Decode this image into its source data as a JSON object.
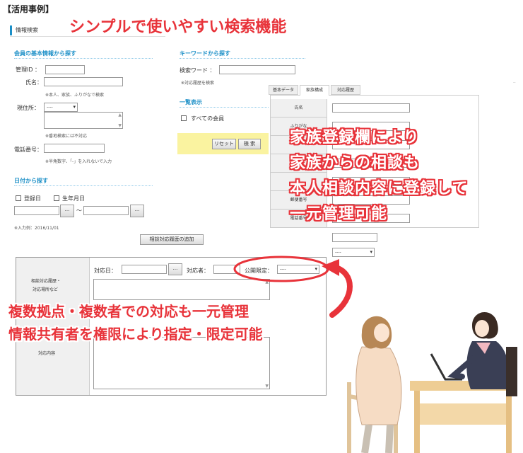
{
  "page_heading": "【活用事例】",
  "tab_info_search": "情報検索",
  "headline": "シンプルで使いやすい検索機能",
  "member_section": {
    "title": "会員の基本情報から探す",
    "admin_id_label": "管理ID ：",
    "name_label": "氏名：",
    "name_note": "※本人、家族、ふりがなで検索",
    "address_label": "現住所：",
    "address_select": "----",
    "address_note": "※番地検索には不対応",
    "phone_label": "電話番号：",
    "phone_note": "※半角数字、「-」を入れないで入力"
  },
  "keyword_section": {
    "title": "キーワードから探す",
    "keyword_label": "検索ワード ：",
    "keyword_note": "※対応履歴を検索"
  },
  "list_section": {
    "title": "一覧表示",
    "all_members_label": "すべての会員"
  },
  "buttons": {
    "reset": "リセット",
    "search": "検 索",
    "add_history": "相談対応履歴の追加",
    "picker": "..."
  },
  "date_section": {
    "title": "日付から探す",
    "registration_date_label": "登録日",
    "birthdate_label": "生年月日",
    "range_sep": "〜",
    "example": "※入力例：2016/11/01"
  },
  "detail_tabs": [
    "基本データ",
    "家族構成",
    "対応履歴"
  ],
  "detail_rows": [
    "氏名",
    "ふりがな",
    "",
    "年齢",
    "",
    "郵便番号",
    "電話番号"
  ],
  "family_overlay_lines": [
    "家族登録欄により",
    "家族からの相談も",
    "本人相談内容に登録して",
    "一元管理可能"
  ],
  "history_form": {
    "row_label_1": "相談対応履歴・",
    "row_label_2": "対応場所など",
    "row_label_3": "対応内容",
    "date_label": "対応日：",
    "person_label": "対応者：",
    "scope_label": "公開限定：",
    "scope_select": "----"
  },
  "bottom_callout_lines": [
    "複数拠点・複数者での対応も一元管理",
    "情報共有者を権限により指定・限定可能"
  ],
  "small_select": "----",
  "colors": {
    "accent_red": "#e8333a",
    "link_blue": "#1b8fc7",
    "highlight_yellow": "#faf3a0"
  }
}
